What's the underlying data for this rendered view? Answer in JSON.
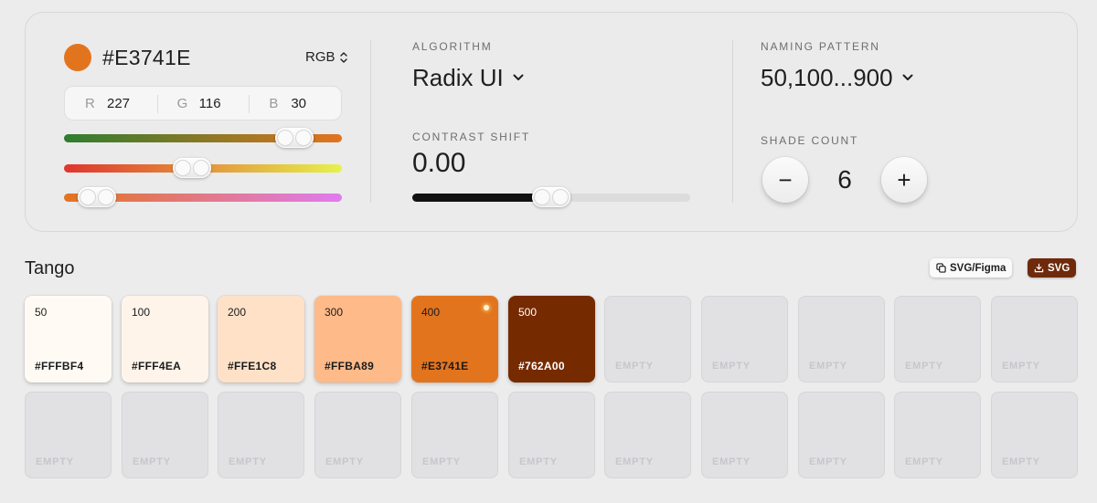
{
  "color": {
    "hex": "#E3741E",
    "swatch": "#E3741E",
    "mode": "RGB",
    "channels": [
      {
        "key": "R",
        "value": "227"
      },
      {
        "key": "G",
        "value": "116"
      },
      {
        "key": "B",
        "value": "30"
      }
    ],
    "sliders": [
      {
        "id": "slider-1",
        "fraction": 0.83,
        "gradient": [
          "#2f7d2f",
          "#e3741e"
        ]
      },
      {
        "id": "slider-2",
        "fraction": 0.46,
        "gradient": [
          "#e0352d",
          "#e6f24b"
        ]
      },
      {
        "id": "slider-3",
        "fraction": 0.12,
        "gradient": [
          "#e3741e",
          "#e07cf0"
        ]
      }
    ]
  },
  "algorithm": {
    "label": "ALGORITHM",
    "value": "Radix UI",
    "contrast_label": "CONTRAST SHIFT",
    "contrast_value": "0.00",
    "contrast_fraction": 0.5
  },
  "naming": {
    "label": "NAMING PATTERN",
    "value": "50,100...900",
    "shade_label": "SHADE COUNT",
    "shade_count": "6",
    "minus": "−",
    "plus": "+"
  },
  "palette": {
    "name": "Tango",
    "export_figma_label": "SVG/Figma",
    "export_svg_label": "SVG",
    "accent": "#6E2A0B",
    "shades": [
      {
        "step": "50",
        "hex": "#FFFBF4",
        "text": "#1b1b1b"
      },
      {
        "step": "100",
        "hex": "#FFF4EA",
        "text": "#1b1b1b"
      },
      {
        "step": "200",
        "hex": "#FFE1C8",
        "text": "#1b1b1b"
      },
      {
        "step": "300",
        "hex": "#FFBA89",
        "text": "#1b1b1b"
      },
      {
        "step": "400",
        "hex": "#E3741E",
        "text": "#1b1b1b"
      },
      {
        "step": "500",
        "hex": "#762A00",
        "text": "#ffffff"
      }
    ],
    "empty_label": "EMPTY"
  }
}
